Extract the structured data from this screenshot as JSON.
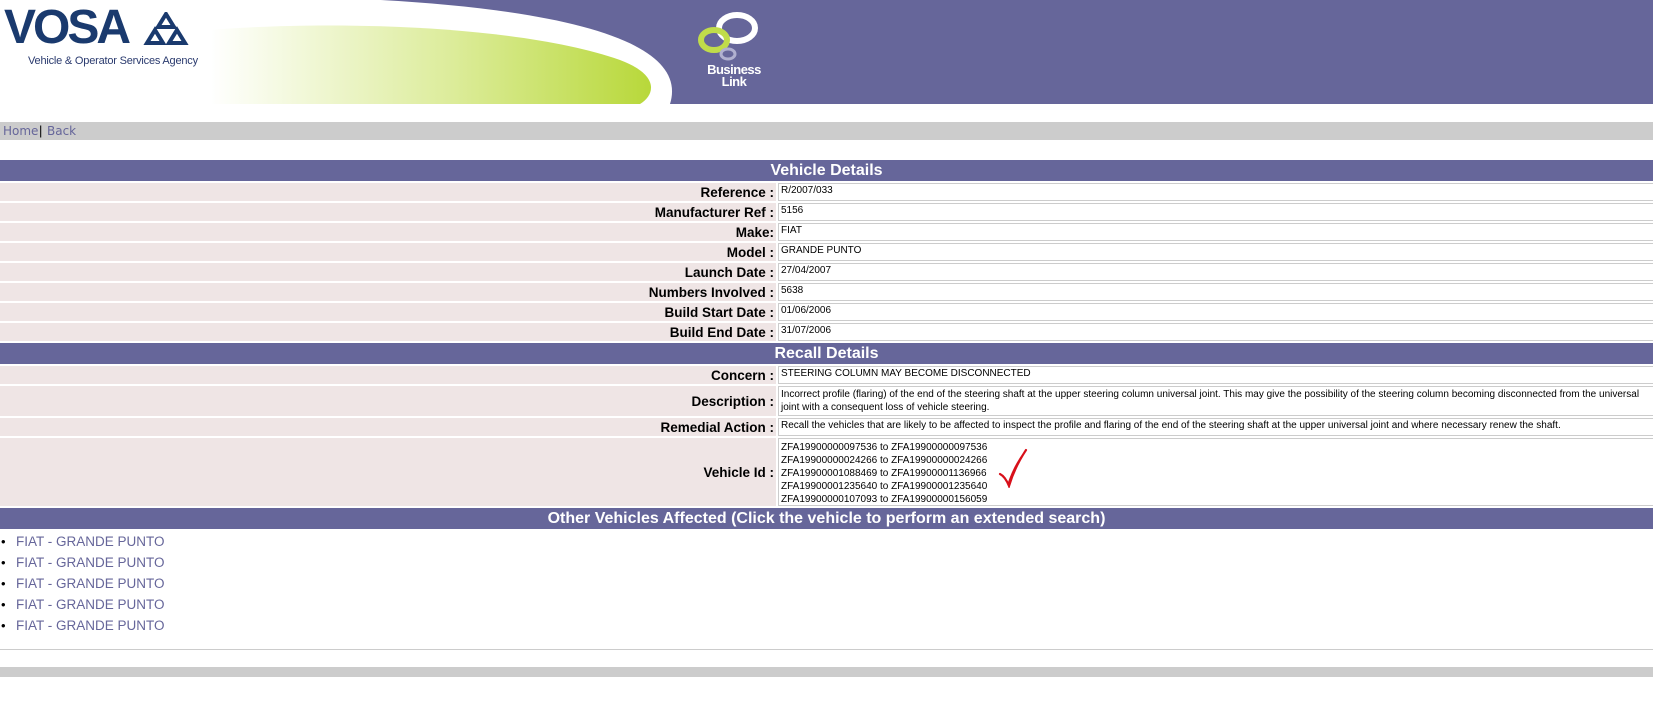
{
  "header": {
    "vosa_logo_text": "VOSA",
    "vosa_tagline": "Vehicle & Operator Services Agency",
    "business_link_text_1": "Business",
    "business_link_text_2": "Link",
    "colors": {
      "band": "#66669a",
      "swoosh": "#c0dc4a",
      "vosa_blue": "#1a3a6e"
    }
  },
  "nav": {
    "home": "Home",
    "separator": "|",
    "back": "Back"
  },
  "vehicle_details": {
    "title": "Vehicle Details",
    "rows": [
      {
        "label": "Reference :",
        "value": "R/2007/033"
      },
      {
        "label": "Manufacturer Ref :",
        "value": "5156"
      },
      {
        "label": "Make:",
        "value": "FIAT"
      },
      {
        "label": "Model :",
        "value": "GRANDE PUNTO"
      },
      {
        "label": "Launch Date :",
        "value": "27/04/2007"
      },
      {
        "label": "Numbers Involved :",
        "value": "5638"
      },
      {
        "label": "Build Start Date :",
        "value": "01/06/2006"
      },
      {
        "label": "Build End Date :",
        "value": "31/07/2006"
      }
    ]
  },
  "recall_details": {
    "title": "Recall Details",
    "concern_label": "Concern :",
    "concern_value": "STEERING COLUMN MAY BECOME DISCONNECTED",
    "description_label": "Description :",
    "description_value": "Incorrect profile (flaring) of the end of the steering shaft at the upper steering column universal joint. This may give the possibility of the steering column becoming disconnected from the universal joint with a consequent loss of vehicle steering.",
    "remedial_label": "Remedial Action :",
    "remedial_value": "Recall the vehicles that are likely to be affected to inspect the profile and flaring of the end of the steering shaft at the upper universal joint and where necessary renew the shaft.",
    "vehicle_id_label": "Vehicle Id :",
    "vehicle_ids": [
      "ZFA19900000097536 to ZFA19900000097536",
      "ZFA19900000024266 to ZFA19900000024266",
      "ZFA19900001088469 to ZFA19900001136966",
      "ZFA19900001235640 to ZFA19900001235640",
      "ZFA19900000107093 to ZFA19900000156059"
    ]
  },
  "other_vehicles": {
    "title": "Other Vehicles Affected (Click the vehicle to perform an extended search)",
    "items": [
      "FIAT - GRANDE PUNTO",
      "FIAT - GRANDE PUNTO",
      "FIAT - GRANDE PUNTO",
      "FIAT - GRANDE PUNTO",
      "FIAT - GRANDE PUNTO"
    ]
  }
}
